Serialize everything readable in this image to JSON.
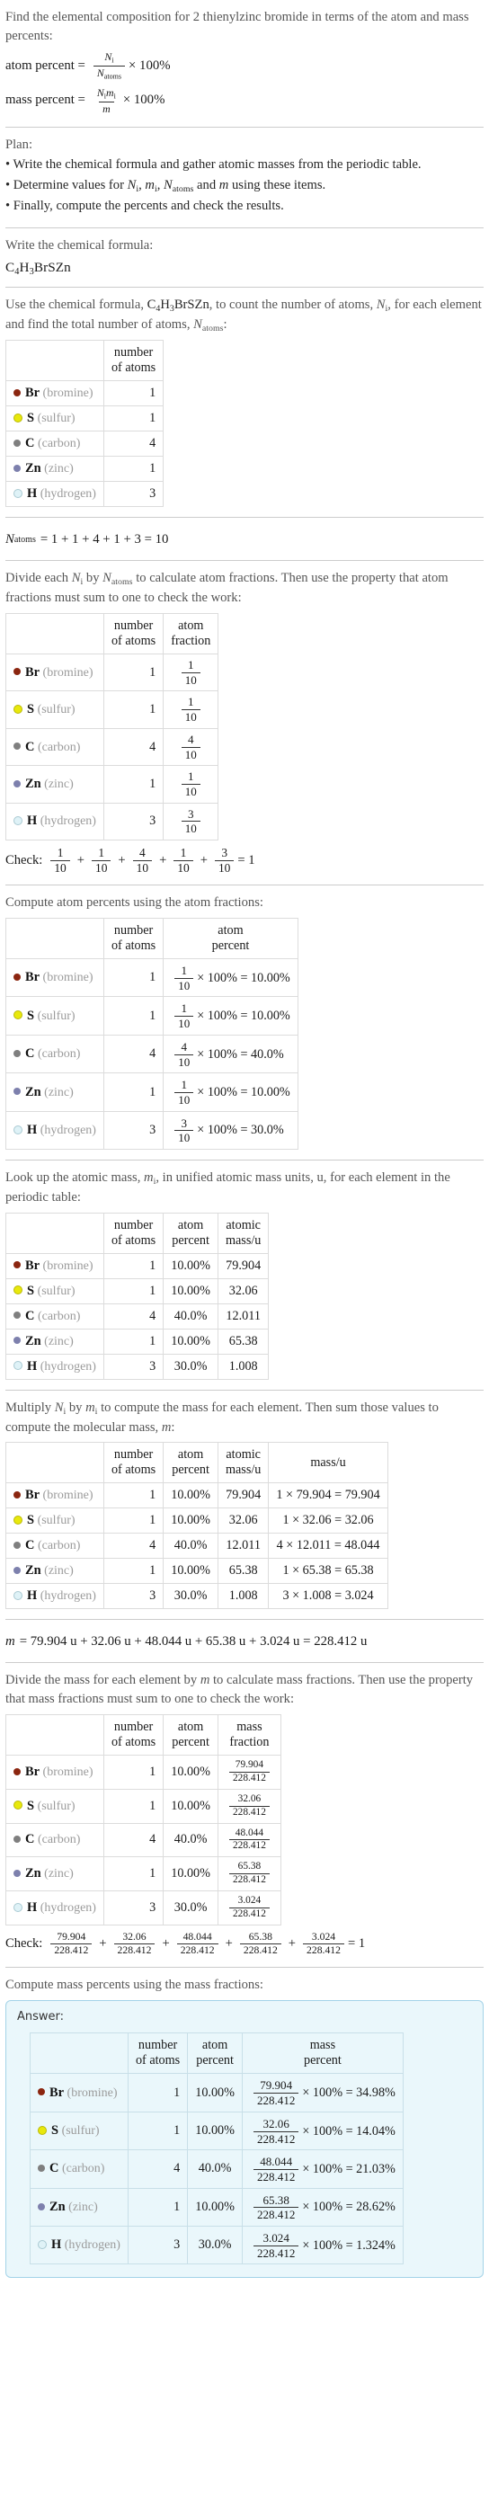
{
  "header": {
    "question": "Find the elemental composition for 2 thienylzinc bromide in terms of the atom and mass percents:",
    "atom_percent_label": "atom percent =",
    "mass_percent_label": "mass percent =",
    "atom_percent_num": "N",
    "atom_percent_num_sub": "i",
    "atom_percent_den": "N",
    "atom_percent_den_sub": "atoms",
    "mass_percent_num": "N",
    "mass_percent_num_sub": "i",
    "mass_percent_num2": "m",
    "mass_percent_num2_sub": "i",
    "mass_percent_den": "m",
    "times_100": "× 100%"
  },
  "plan": {
    "title": "Plan:",
    "bullets": [
      "• Write the chemical formula and gather atomic masses from the periodic table.",
      "• Finally, compute the percents and check the results."
    ],
    "bullet2_pre": "• Determine values for ",
    "bullet2_mid": ", and ",
    "bullet2_post": " using these items."
  },
  "formula_section": {
    "prompt": "Write the chemical formula:",
    "formula_plain": "C4H3BrSZn"
  },
  "count_section": {
    "prompt_a": "Use the chemical formula, ",
    "prompt_b": ", to count the number of atoms, ",
    "prompt_c": ", for each element and find the total number of atoms, ",
    "prompt_d": ":",
    "col_blank": "",
    "col_atoms": "number\nof atoms",
    "total_line": "Natoms = 1 + 1 + 4 + 1 + 3 = 10",
    "total_lhs": "N",
    "total_lhs_sub": "atoms",
    "total_rhs": "= 1 + 1 + 4 + 1 + 3 = 10"
  },
  "fraction_section": {
    "prompt_a": "Divide each ",
    "prompt_b": " by ",
    "prompt_c": " to calculate atom fractions. Then use the property that atom fractions must sum to one to check the work:",
    "col_atoms": "number\nof atoms",
    "col_fraction": "atom\nfraction",
    "check_label": "Check:",
    "check_result": "= 1"
  },
  "atompct_section": {
    "prompt": "Compute atom percents using the atom fractions:",
    "col_atoms": "number\nof atoms",
    "col_percent": "atom\npercent"
  },
  "atomicmass_section": {
    "prompt": "Look up the atomic mass, mi, in unified atomic mass units, u, for each element in the periodic table:",
    "prompt_a": "Look up the atomic mass, ",
    "prompt_b": ", in unified atomic mass units, u, for each element in the periodic table:",
    "col_atoms": "number\nof atoms",
    "col_percent": "atom\npercent",
    "col_mass": "atomic\nmass/u"
  },
  "massu_section": {
    "prompt_a": "Multiply ",
    "prompt_b": " by ",
    "prompt_c": " to compute the mass for each element. Then sum those values to compute the molecular mass, ",
    "prompt_d": ":",
    "col_atoms": "number\nof atoms",
    "col_percent": "atom\npercent",
    "col_atomicmass": "atomic\nmass/u",
    "col_massu": "mass/u",
    "molecular_mass_line": "m = 79.904 u + 32.06 u + 48.044 u + 65.38 u + 3.024 u = 228.412 u",
    "molecular_mass_rhs": "= 79.904 u + 32.06 u + 48.044 u + 65.38 u + 3.024 u = 228.412 u"
  },
  "massfrac_section": {
    "prompt_a": "Divide the mass for each element by ",
    "prompt_b": " to calculate mass fractions. Then use the property that mass fractions must sum to one to check the work:",
    "col_atoms": "number\nof atoms",
    "col_percent": "atom\npercent",
    "col_massfrac": "mass\nfraction",
    "check_label": "Check:",
    "check_result": "= 1"
  },
  "masspct_section": {
    "prompt": "Compute mass percents using the mass fractions:",
    "answer_label": "Answer:",
    "col_atoms": "number\nof atoms",
    "col_percent": "atom\npercent",
    "col_masspercent": "mass\npercent"
  },
  "molecular_mass": "228.412",
  "n_atoms_total": "10",
  "elements": [
    {
      "symbol": "Br",
      "name": "(bromine)",
      "color": "#8b2610",
      "filled": true,
      "count": "1",
      "fraction_num": "1",
      "fraction_den": "10",
      "atom_percent": "10.00%",
      "atom_percent_expr": "× 100% = 10.00%",
      "atomic_mass": "79.904",
      "mass_expr": "1 × 79.904 = 79.904",
      "mass_value": "79.904",
      "mass_percent": "34.98%",
      "mass_percent_expr": "× 100% = 34.98%"
    },
    {
      "symbol": "S",
      "name": "(sulfur)",
      "color": "#e8e80c",
      "filled": true,
      "count": "1",
      "fraction_num": "1",
      "fraction_den": "10",
      "atom_percent": "10.00%",
      "atom_percent_expr": "× 100% = 10.00%",
      "atomic_mass": "32.06",
      "mass_expr": "1 × 32.06 = 32.06",
      "mass_value": "32.06",
      "mass_percent": "14.04%",
      "mass_percent_expr": "× 100% = 14.04%"
    },
    {
      "symbol": "C",
      "name": "(carbon)",
      "color": "#7f7f7f",
      "filled": true,
      "count": "4",
      "fraction_num": "4",
      "fraction_den": "10",
      "atom_percent": "40.0%",
      "atom_percent_expr": "× 100% = 40.0%",
      "atomic_mass": "12.011",
      "mass_expr": "4 × 12.011 = 48.044",
      "mass_value": "48.044",
      "mass_percent": "21.03%",
      "mass_percent_expr": "× 100% = 21.03%"
    },
    {
      "symbol": "Zn",
      "name": "(zinc)",
      "color": "#7d80ad",
      "filled": true,
      "count": "1",
      "fraction_num": "1",
      "fraction_den": "10",
      "atom_percent": "10.00%",
      "atom_percent_expr": "× 100% = 10.00%",
      "atomic_mass": "65.38",
      "mass_expr": "1 × 65.38 = 65.38",
      "mass_value": "65.38",
      "mass_percent": "28.62%",
      "mass_percent_expr": "× 100% = 28.62%"
    },
    {
      "symbol": "H",
      "name": "(hydrogen)",
      "color": "#dff2f7",
      "filled": false,
      "count": "3",
      "fraction_num": "3",
      "fraction_den": "10",
      "atom_percent": "30.0%",
      "atom_percent_expr": "× 100% = 30.0%",
      "atomic_mass": "1.008",
      "mass_expr": "3 × 1.008 = 3.024",
      "mass_value": "3.024",
      "mass_percent": "1.324%",
      "mass_percent_expr": "× 100% = 1.324%"
    }
  ],
  "chart_data": {
    "type": "table",
    "title": "Elemental composition of 2 thienylzinc bromide (C4H3BrSZn)",
    "categories": [
      "Br (bromine)",
      "S (sulfur)",
      "C (carbon)",
      "Zn (zinc)",
      "H (hydrogen)"
    ],
    "series": [
      {
        "name": "number of atoms",
        "values": [
          1,
          1,
          4,
          1,
          3
        ]
      },
      {
        "name": "atom percent",
        "values": [
          10.0,
          10.0,
          40.0,
          10.0,
          30.0
        ]
      },
      {
        "name": "atomic mass/u",
        "values": [
          79.904,
          32.06,
          12.011,
          65.38,
          1.008
        ]
      },
      {
        "name": "mass/u",
        "values": [
          79.904,
          32.06,
          48.044,
          65.38,
          3.024
        ]
      },
      {
        "name": "mass percent",
        "values": [
          34.98,
          14.04,
          21.03,
          28.62,
          1.324
        ]
      }
    ],
    "total_atoms": 10,
    "molecular_mass_u": 228.412
  }
}
